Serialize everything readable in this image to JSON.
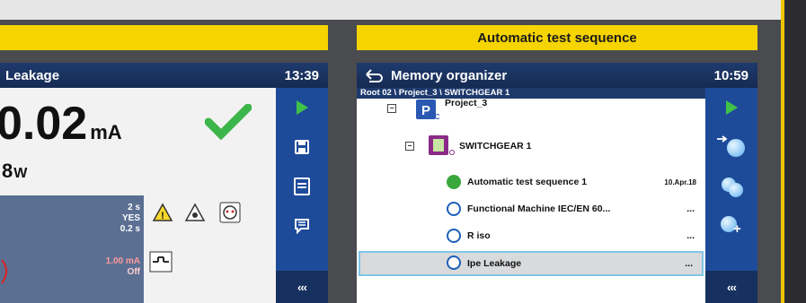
{
  "left_screen": {
    "title": "Leakage",
    "time": "13:39",
    "main_value": "0.02",
    "main_unit": "mA",
    "power_value": "8",
    "power_unit": "W",
    "params": [
      "2 s",
      "YES",
      "0.2 s"
    ],
    "limits": [
      "1.00 mA",
      "Off"
    ]
  },
  "right_panel": {
    "heading": "Automatic test sequence"
  },
  "right_screen": {
    "title": "Memory organizer",
    "time": "10:59",
    "breadcrumb": "Root 02 \\ Project_3 \\ SWITCHGEAR 1",
    "tree": [
      {
        "label": "Project_3",
        "value": ""
      },
      {
        "label": "SWITCHGEAR 1",
        "value": ""
      },
      {
        "label": "Automatic test sequence 1",
        "value": "10.Apr.18"
      },
      {
        "label": "Functional Machine IEC/EN 60...",
        "value": "..."
      },
      {
        "label": "R iso",
        "value": "..."
      },
      {
        "label": "Ipe Leakage",
        "value": "..."
      }
    ]
  },
  "sidebar": {
    "back_label": "‹‹‹"
  },
  "colors": {
    "accent_yellow": "#f6d400",
    "titlebar_blue": "#1e3a6d",
    "sidebar_blue": "#1d4b99",
    "pass_green": "#40c24a"
  },
  "icons": [
    "back-arrow-icon",
    "play-icon",
    "save-icon",
    "list-icon",
    "comment-icon",
    "checkmark-icon",
    "warning-icon",
    "fuse-icon",
    "project-icon",
    "switchgear-icon",
    "add-circle-icon",
    "move-circle-icon"
  ]
}
